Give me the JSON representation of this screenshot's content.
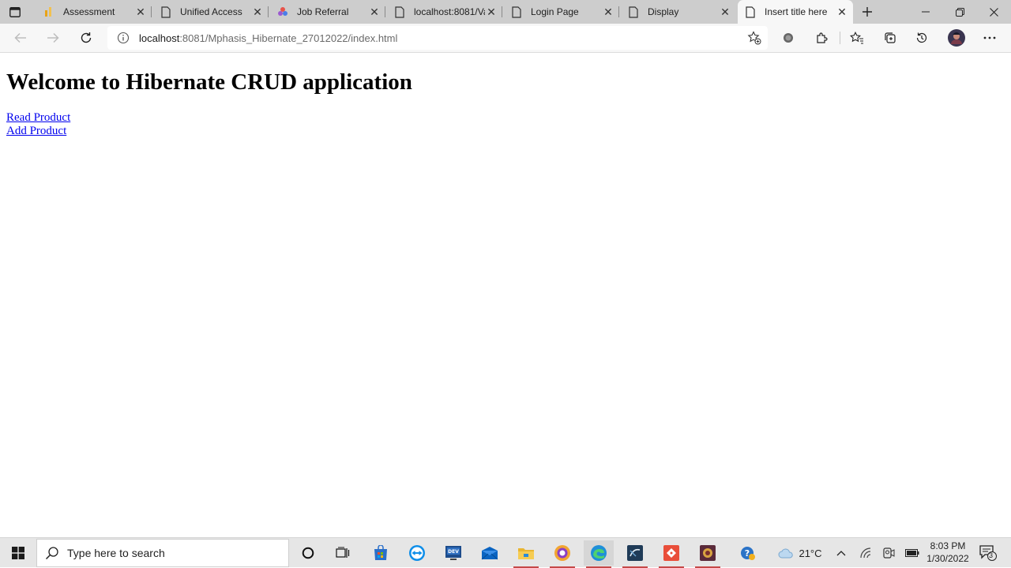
{
  "browser": {
    "tabs": [
      {
        "title": "Assessment",
        "icon": "chart-favicon-icon"
      },
      {
        "title": "Unified Access",
        "icon": "page-icon"
      },
      {
        "title": "Job Referral",
        "icon": "pinwheel-favicon-icon"
      },
      {
        "title": "localhost:8081/Va",
        "icon": "page-icon"
      },
      {
        "title": "Login Page",
        "icon": "page-icon"
      },
      {
        "title": "Display",
        "icon": "page-icon"
      },
      {
        "title": "Insert title here",
        "icon": "page-icon",
        "active": true
      }
    ],
    "address": {
      "host": "localhost",
      "path": ":8081/Mphasis_Hibernate_27012022/index.html"
    }
  },
  "page": {
    "heading": "Welcome to Hibernate CRUD application",
    "links": [
      "Read Product",
      "Add Product"
    ]
  },
  "taskbar": {
    "search_placeholder": "Type here to search",
    "weather": "21°C",
    "time": "8:03 PM",
    "date": "1/30/2022",
    "notification_count": "3"
  },
  "colors": {
    "tab_strip": "#cdcdcd",
    "active_tab": "#f7f7f7",
    "link": "#0000ee",
    "taskbar": "#e6e6e6"
  }
}
